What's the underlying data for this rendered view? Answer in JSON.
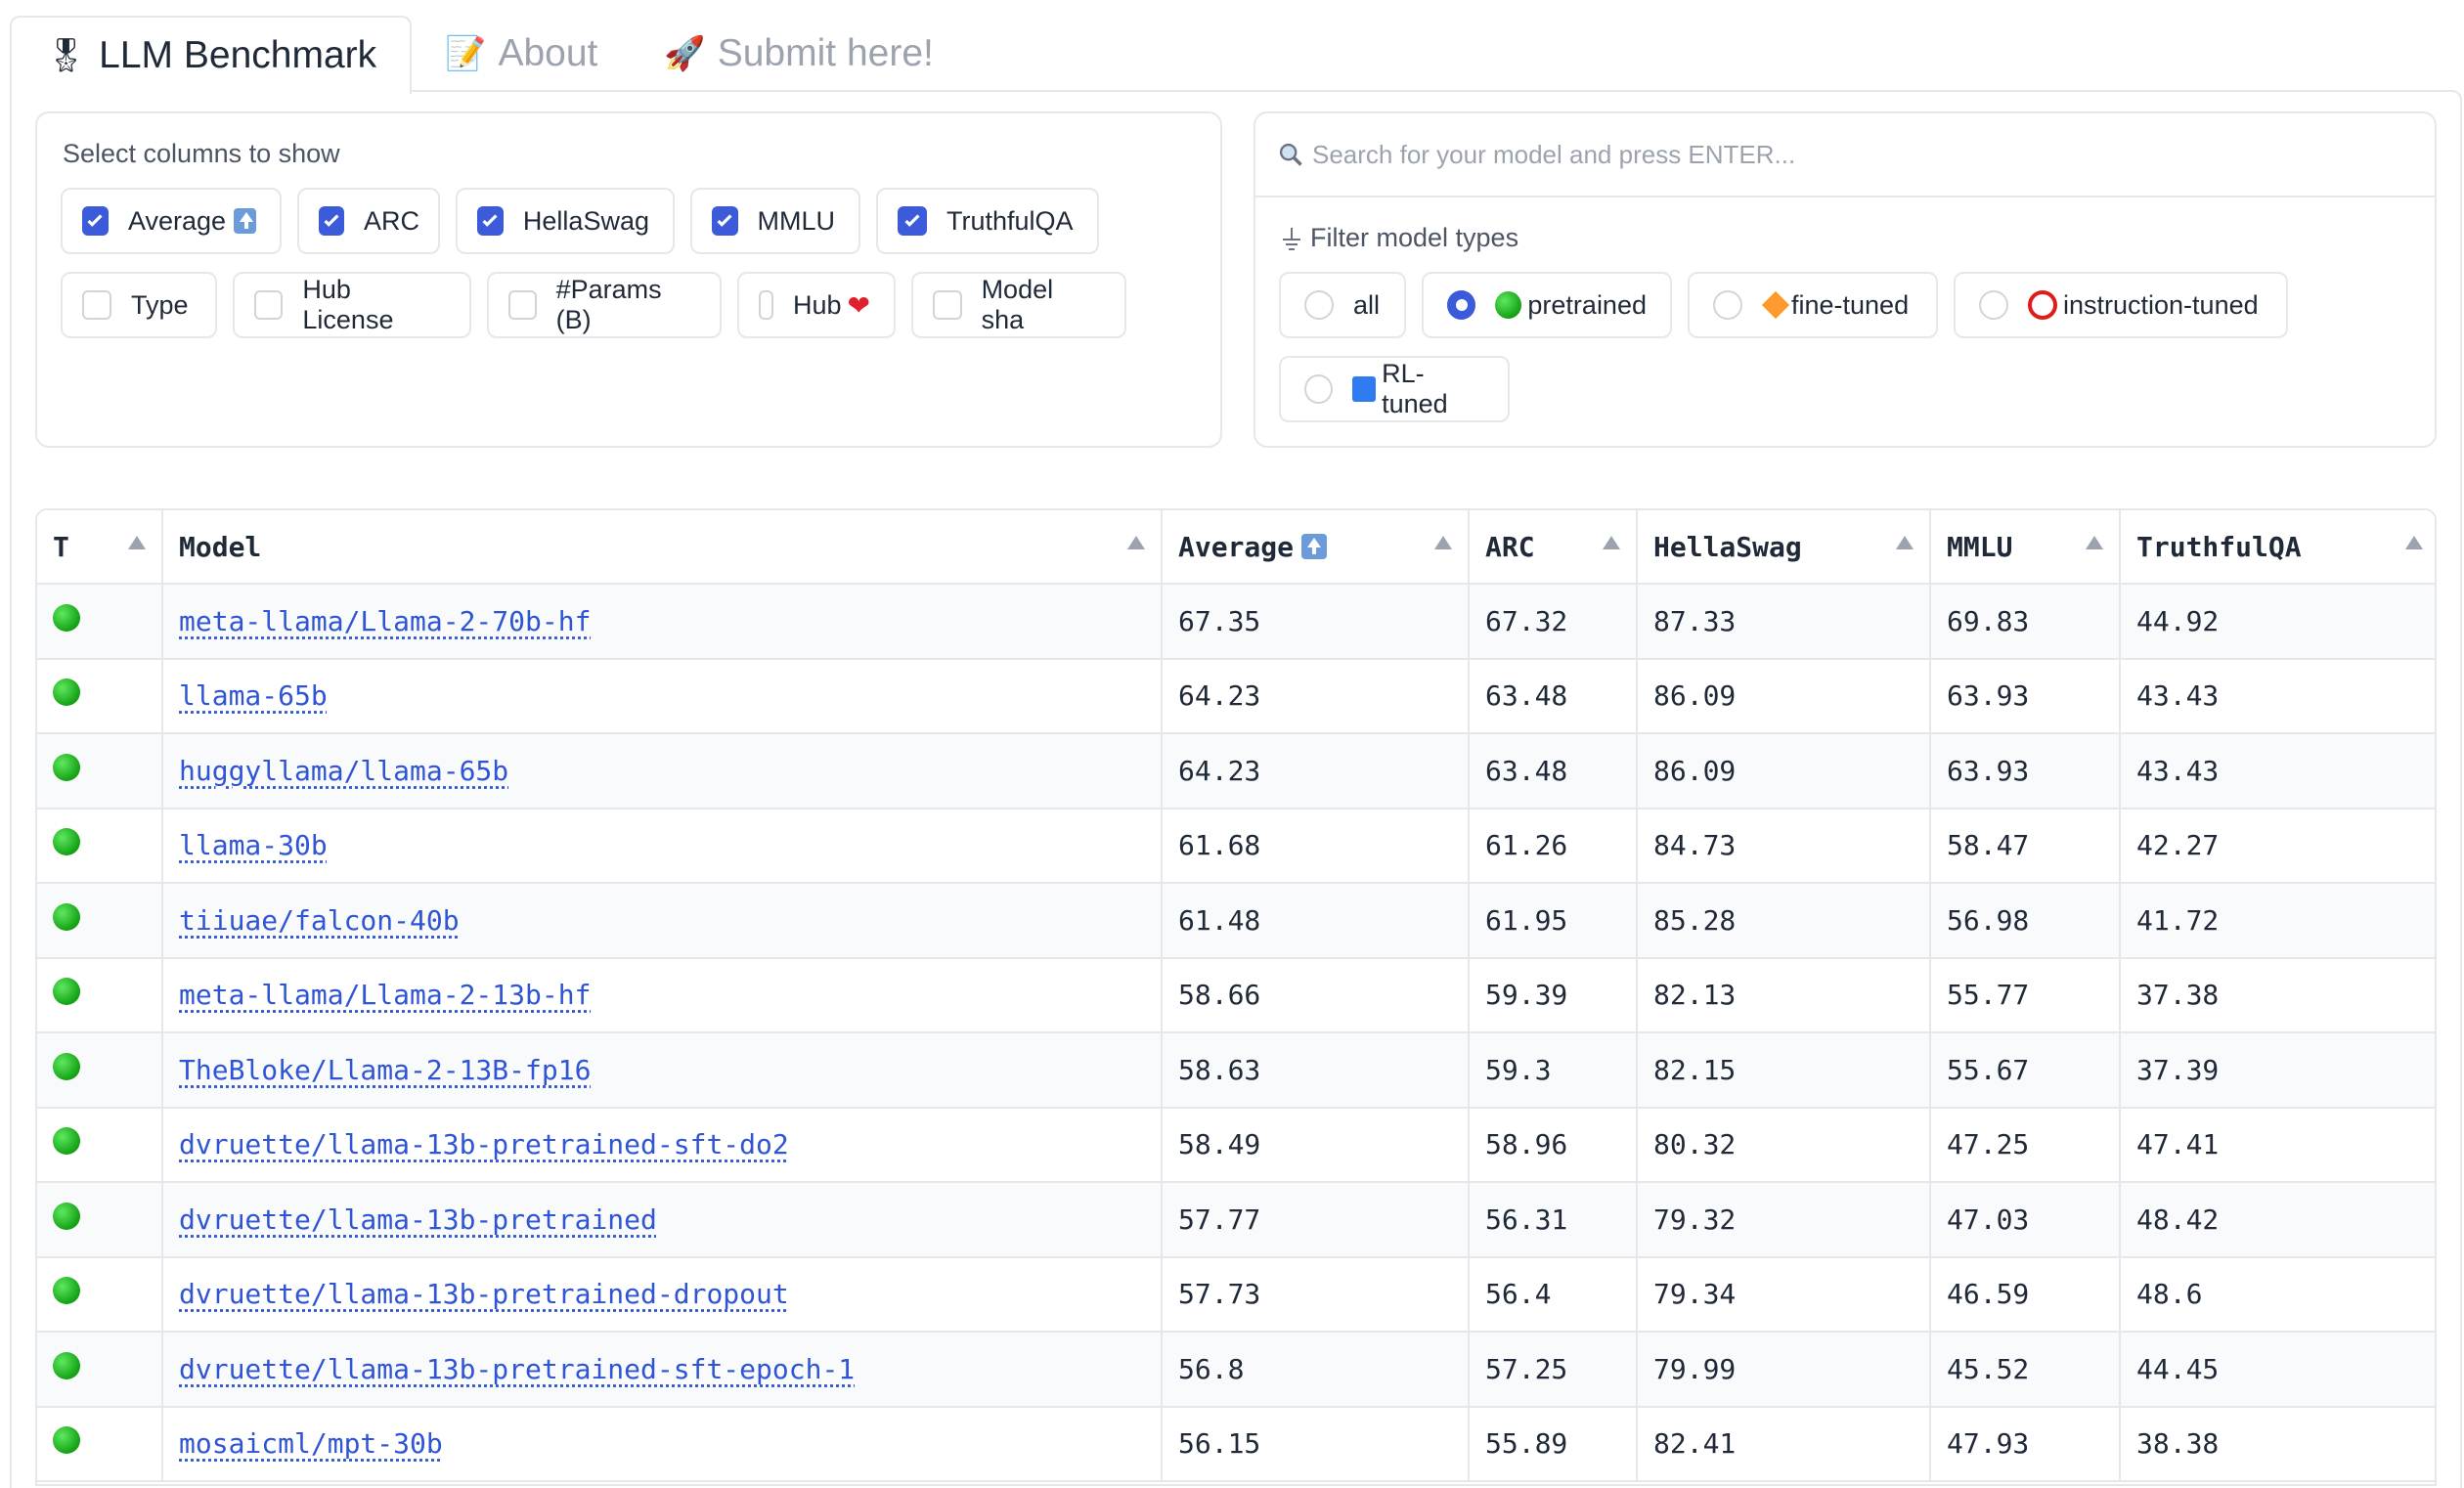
{
  "tabs": [
    {
      "label": "LLM Benchmark",
      "icon": "medal-icon",
      "emoji": "🎖",
      "active": true
    },
    {
      "label": "About",
      "icon": "memo-icon",
      "emoji": "📝",
      "active": false
    },
    {
      "label": "Submit here!",
      "icon": "rocket-icon",
      "emoji": "🚀",
      "active": false
    }
  ],
  "columns_panel": {
    "title": "Select columns to show",
    "options": [
      {
        "label": "Average",
        "checked": true
      },
      {
        "label": "ARC",
        "checked": true
      },
      {
        "label": "HellaSwag",
        "checked": true
      },
      {
        "label": "MMLU",
        "checked": true
      },
      {
        "label": "TruthfulQA",
        "checked": true
      },
      {
        "label": "Type",
        "checked": false
      },
      {
        "label": "Hub License",
        "checked": false
      },
      {
        "label": "#Params (B)",
        "checked": false
      },
      {
        "label": "Hub",
        "checked": false
      },
      {
        "label": "Model sha",
        "checked": false
      }
    ]
  },
  "search": {
    "placeholder": "Search for your model and press ENTER..."
  },
  "filter": {
    "title": "Filter model types",
    "options": [
      {
        "label": "all",
        "selected": false
      },
      {
        "label": "pretrained",
        "selected": true
      },
      {
        "label": "fine-tuned",
        "selected": false
      },
      {
        "label": "instruction-tuned",
        "selected": false
      },
      {
        "label": "RL-tuned",
        "selected": false
      }
    ]
  },
  "table": {
    "headers": [
      "T",
      "Model",
      "Average",
      "ARC",
      "HellaSwag",
      "MMLU",
      "TruthfulQA"
    ],
    "rows": [
      {
        "model": "meta-llama/Llama-2-70b-hf",
        "avg": "67.35",
        "arc": "67.32",
        "hella": "87.33",
        "mmlu": "69.83",
        "tqa": "44.92"
      },
      {
        "model": "llama-65b",
        "avg": "64.23",
        "arc": "63.48",
        "hella": "86.09",
        "mmlu": "63.93",
        "tqa": "43.43"
      },
      {
        "model": "huggyllama/llama-65b",
        "avg": "64.23",
        "arc": "63.48",
        "hella": "86.09",
        "mmlu": "63.93",
        "tqa": "43.43"
      },
      {
        "model": "llama-30b",
        "avg": "61.68",
        "arc": "61.26",
        "hella": "84.73",
        "mmlu": "58.47",
        "tqa": "42.27"
      },
      {
        "model": "tiiuae/falcon-40b",
        "avg": "61.48",
        "arc": "61.95",
        "hella": "85.28",
        "mmlu": "56.98",
        "tqa": "41.72"
      },
      {
        "model": "meta-llama/Llama-2-13b-hf",
        "avg": "58.66",
        "arc": "59.39",
        "hella": "82.13",
        "mmlu": "55.77",
        "tqa": "37.38"
      },
      {
        "model": "TheBloke/Llama-2-13B-fp16",
        "avg": "58.63",
        "arc": "59.3",
        "hella": "82.15",
        "mmlu": "55.67",
        "tqa": "37.39"
      },
      {
        "model": "dvruette/llama-13b-pretrained-sft-do2",
        "avg": "58.49",
        "arc": "58.96",
        "hella": "80.32",
        "mmlu": "47.25",
        "tqa": "47.41"
      },
      {
        "model": "dvruette/llama-13b-pretrained",
        "avg": "57.77",
        "arc": "56.31",
        "hella": "79.32",
        "mmlu": "47.03",
        "tqa": "48.42"
      },
      {
        "model": "dvruette/llama-13b-pretrained-dropout",
        "avg": "57.73",
        "arc": "56.4",
        "hella": "79.34",
        "mmlu": "46.59",
        "tqa": "48.6"
      },
      {
        "model": "dvruette/llama-13b-pretrained-sft-epoch-1",
        "avg": "56.8",
        "arc": "57.25",
        "hella": "79.99",
        "mmlu": "45.52",
        "tqa": "44.45"
      },
      {
        "model": "mosaicml/mpt-30b",
        "avg": "56.15",
        "arc": "55.89",
        "hella": "82.41",
        "mmlu": "47.93",
        "tqa": "38.38"
      }
    ]
  }
}
